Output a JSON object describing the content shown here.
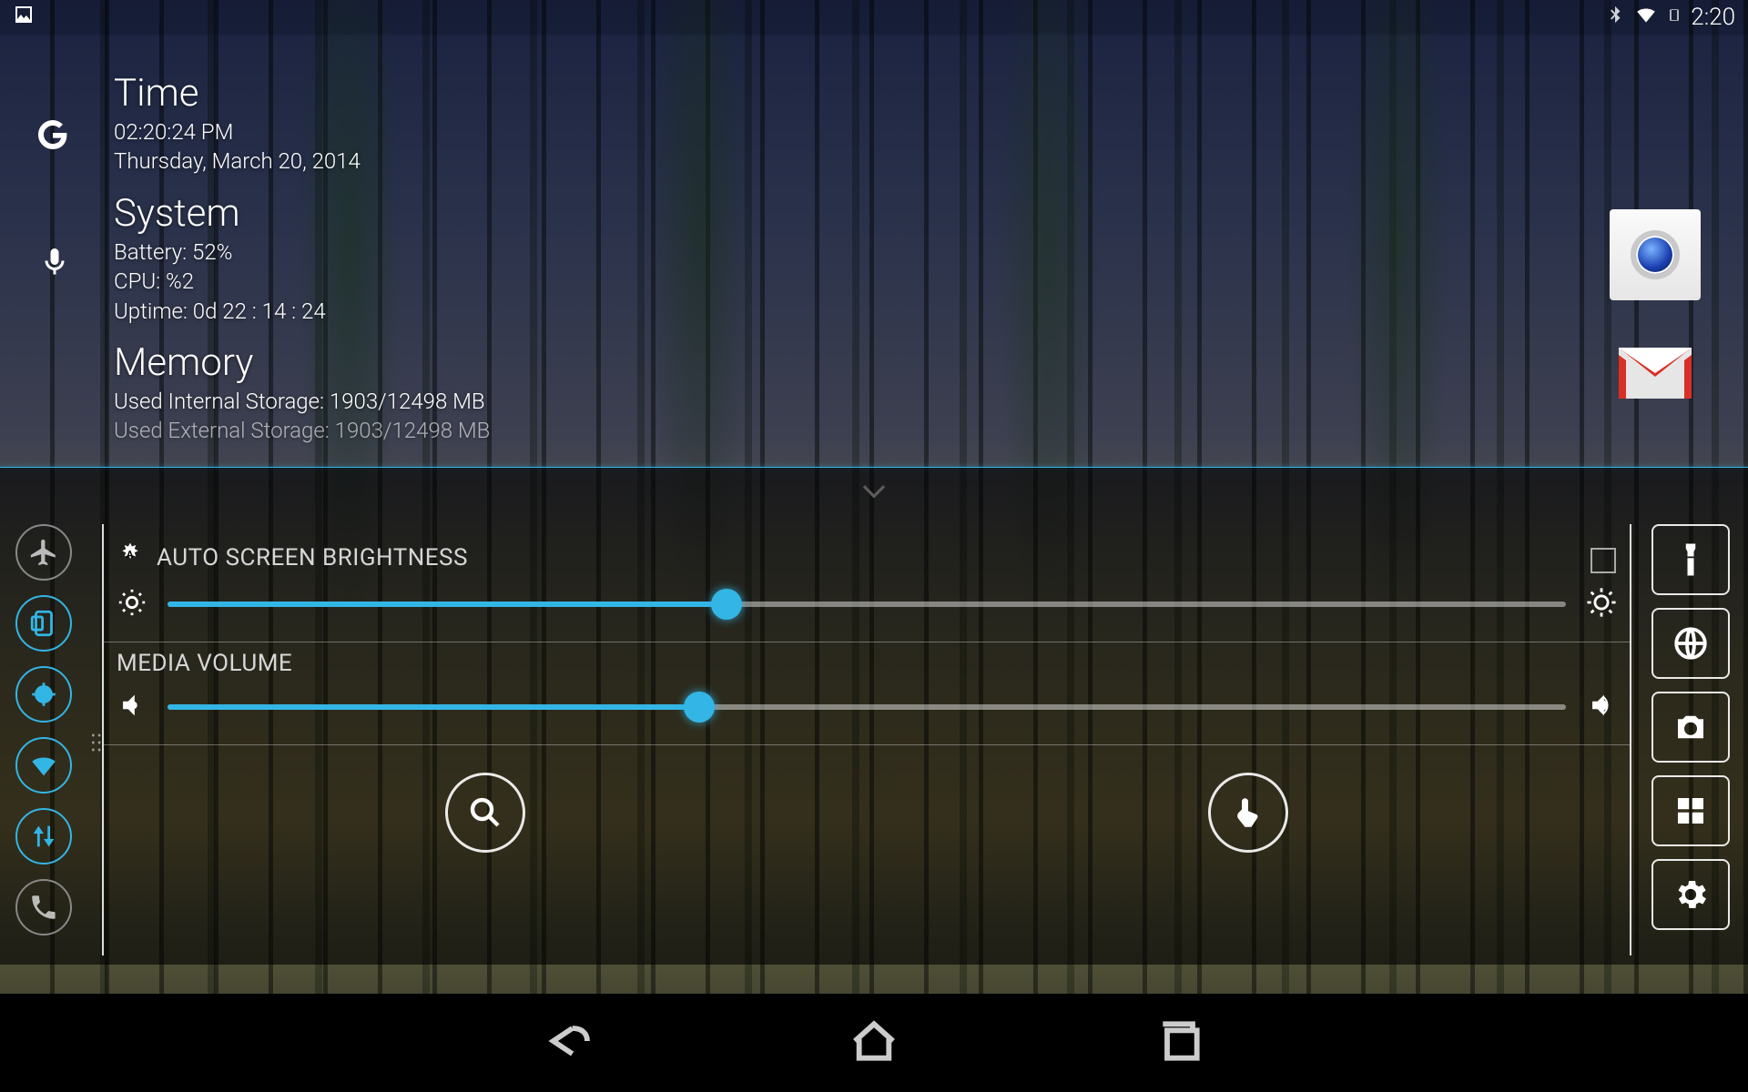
{
  "status": {
    "clock": "2:20"
  },
  "widget": {
    "time": {
      "heading": "Time",
      "clock": "02:20:24 PM",
      "date": "Thursday, March 20, 2014"
    },
    "system": {
      "heading": "System",
      "battery": "Battery: 52%",
      "cpu": "CPU: %2",
      "uptime": "Uptime: 0d 22 : 14 : 24"
    },
    "memory": {
      "heading": "Memory",
      "internal": "Used Internal Storage: 1903/12498 MB",
      "external": "Used External Storage: 1903/12498 MB"
    }
  },
  "panel": {
    "brightness": {
      "label": "AUTO SCREEN BRIGHTNESS",
      "percent": 40
    },
    "volume": {
      "label": "MEDIA VOLUME",
      "percent": 38
    }
  },
  "colors": {
    "accent": "#33b5e5"
  }
}
